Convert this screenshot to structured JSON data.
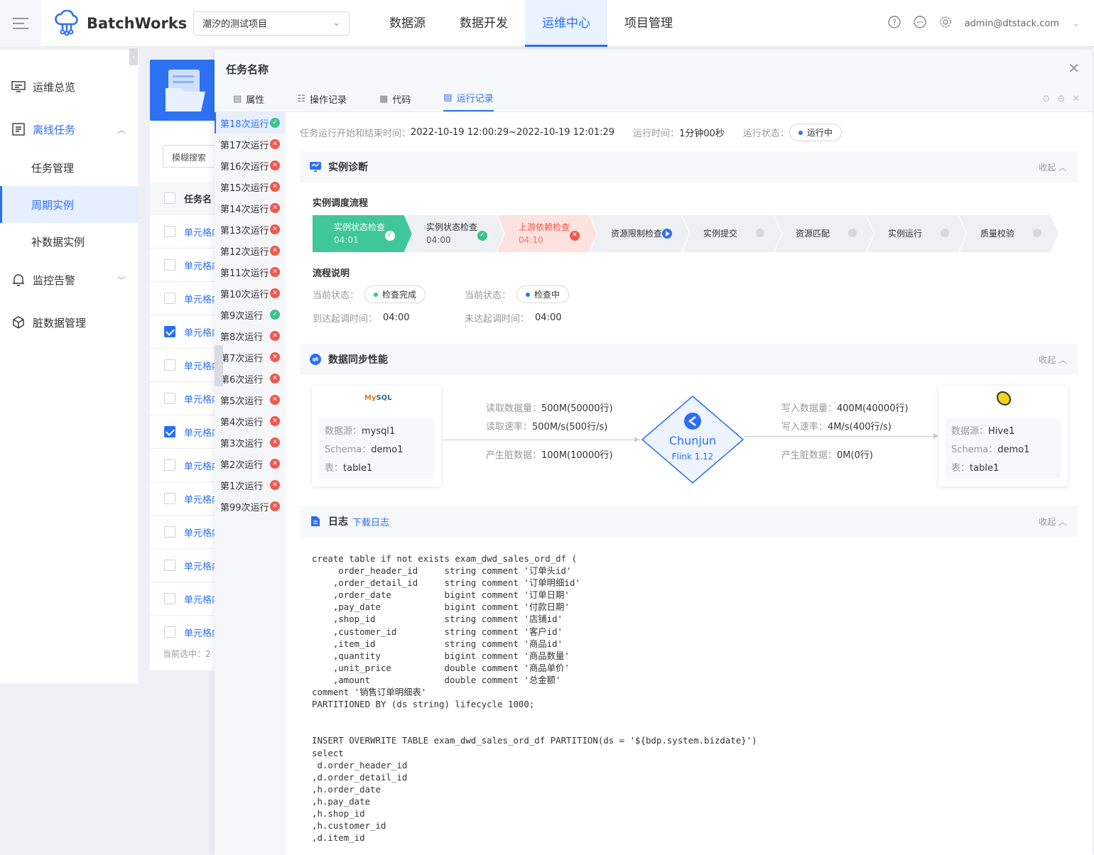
{
  "app": {
    "name": "BatchWorks",
    "project": "潮汐的测试项目",
    "user": "admin@dtstack.com"
  },
  "nav": {
    "items": [
      "数据源",
      "数据开发",
      "运维中心",
      "项目管理"
    ],
    "active": "运维中心"
  },
  "sidebar": {
    "overview": "运维总览",
    "offline": "离线任务",
    "task_manage": "任务管理",
    "cycle_instance": "周期实例",
    "patch_instance": "补数据实例",
    "monitor": "监控告警",
    "dirty": "脏数据管理"
  },
  "list": {
    "search_label": "模糊搜索",
    "header": "任务名",
    "rows": [
      "单元格内",
      "单元格内",
      "单元格内",
      "单元格内",
      "单元格内",
      "单元格内",
      "单元格内",
      "单元格内",
      "单元格内",
      "单元格内",
      "单元格内",
      "单元格内",
      "单元格内"
    ],
    "checked": [
      false,
      false,
      false,
      true,
      false,
      false,
      true,
      false,
      false,
      false,
      false,
      false,
      false
    ],
    "footer": "当前选中：2"
  },
  "drawer": {
    "title": "任务名称",
    "tabs": [
      "属性",
      "操作记录",
      "代码",
      "运行记录"
    ],
    "active_tab": "运行记录",
    "runs": [
      {
        "label": "第18次运行",
        "status": "ok"
      },
      {
        "label": "第17次运行",
        "status": "fail"
      },
      {
        "label": "第16次运行",
        "status": "fail"
      },
      {
        "label": "第15次运行",
        "status": "fail"
      },
      {
        "label": "第14次运行",
        "status": "fail"
      },
      {
        "label": "第13次运行",
        "status": "fail"
      },
      {
        "label": "第12次运行",
        "status": "fail"
      },
      {
        "label": "第11次运行",
        "status": "fail"
      },
      {
        "label": "第10次运行",
        "status": "fail"
      },
      {
        "label": "第9次运行",
        "status": "ok"
      },
      {
        "label": "第8次运行",
        "status": "fail"
      },
      {
        "label": "第7次运行",
        "status": "fail"
      },
      {
        "label": "第6次运行",
        "status": "fail"
      },
      {
        "label": "第5次运行",
        "status": "fail"
      },
      {
        "label": "第4次运行",
        "status": "fail"
      },
      {
        "label": "第3次运行",
        "status": "fail"
      },
      {
        "label": "第2次运行",
        "status": "fail"
      },
      {
        "label": "第1次运行",
        "status": "fail"
      },
      {
        "label": "第99次运行",
        "status": "fail"
      }
    ],
    "meta": {
      "time_label": "任务运行开始和结束时间：",
      "time_value": "2022-10-19 12:00:29~2022-10-19 12:01:29",
      "dur_label": "运行时间：",
      "dur_value": "1分钟00秒",
      "status_label": "运行状态：",
      "status_value": "运行中"
    },
    "diag": {
      "title": "实例诊断",
      "collapse": "收起",
      "flow_title": "实例调度流程",
      "steps": [
        {
          "name": "实例状态检查",
          "time": "04:01",
          "state": "ok"
        },
        {
          "name": "实例状态检查",
          "time": "04:00",
          "state": "done"
        },
        {
          "name": "上游依赖检查",
          "time": "04:10",
          "state": "fail"
        },
        {
          "name": "资源限制检查",
          "time": "",
          "state": "running"
        },
        {
          "name": "实例提交",
          "time": "",
          "state": "wait"
        },
        {
          "name": "资源匹配",
          "time": "",
          "state": "wait"
        },
        {
          "name": "实例运行",
          "time": "",
          "state": "wait"
        },
        {
          "name": "质量校验",
          "time": "",
          "state": "wait"
        }
      ],
      "desc_title": "流程说明",
      "cur_label": "当前状态：",
      "cur1": "检查完成",
      "cur2": "检查中",
      "arrive_label": "到达起调时间：",
      "arrive_value": "04:00",
      "notarrive_label": "未达起调时间：",
      "notarrive_value": "04:00"
    },
    "sync": {
      "title": "数据同步性能",
      "collapse": "收起",
      "src": {
        "logo": "MySQL",
        "ds_label": "数据源：",
        "ds": "mysql1",
        "schema_label": "Schema：",
        "schema": "demo1",
        "table_label": "表：",
        "table": "table1"
      },
      "dst": {
        "ds_label": "数据源：",
        "ds": "Hive1",
        "schema_label": "Schema：",
        "schema": "demo1",
        "table_label": "表：",
        "table": "table1"
      },
      "read_amount_label": "读取数据量：",
      "read_amount": "500M(50000行)",
      "read_rate_label": "读取速率：",
      "read_rate": "500M/s(500行/s)",
      "dirty_in_label": "产生脏数据：",
      "dirty_in": "100M(10000行)",
      "write_amount_label": "写入数据量：",
      "write_amount": "400M(40000行)",
      "write_rate_label": "写入速率：",
      "write_rate": "4M/s(400行/s)",
      "dirty_out_label": "产生脏数据：",
      "dirty_out": "0M(0行)",
      "engine": "Chunjun",
      "engine_ver": "Flink 1.12"
    },
    "log": {
      "title": "日志",
      "download": "下载日志",
      "collapse": "收起",
      "code": "create table if not exists exam_dwd_sales_ord_df (\n     order_header_id     string comment '订单头id'\n    ,order_detail_id     string comment '订单明细id'\n    ,order_date          bigint comment '订单日期'\n    ,pay_date            bigint comment '付款日期'\n    ,shop_id             string comment '店铺id'\n    ,customer_id         string comment '客户id'\n    ,item_id             string comment '商品id'\n    ,quantity            bigint comment '商品数量'\n    ,unit_price          double comment '商品单价'\n    ,amount              double comment '总金额'\ncomment '销售订单明细表'\nPARTITIONED BY (ds string) lifecycle 1000;\n\n\nINSERT OVERWRITE TABLE exam_dwd_sales_ord_df PARTITION(ds = '${bdp.system.bizdate}')\nselect\n d.order_header_id\n,d.order_detail_id\n,h.order_date\n,h.pay_date\n,h.shop_id\n,h.customer_id\n,d.item_id"
    }
  }
}
